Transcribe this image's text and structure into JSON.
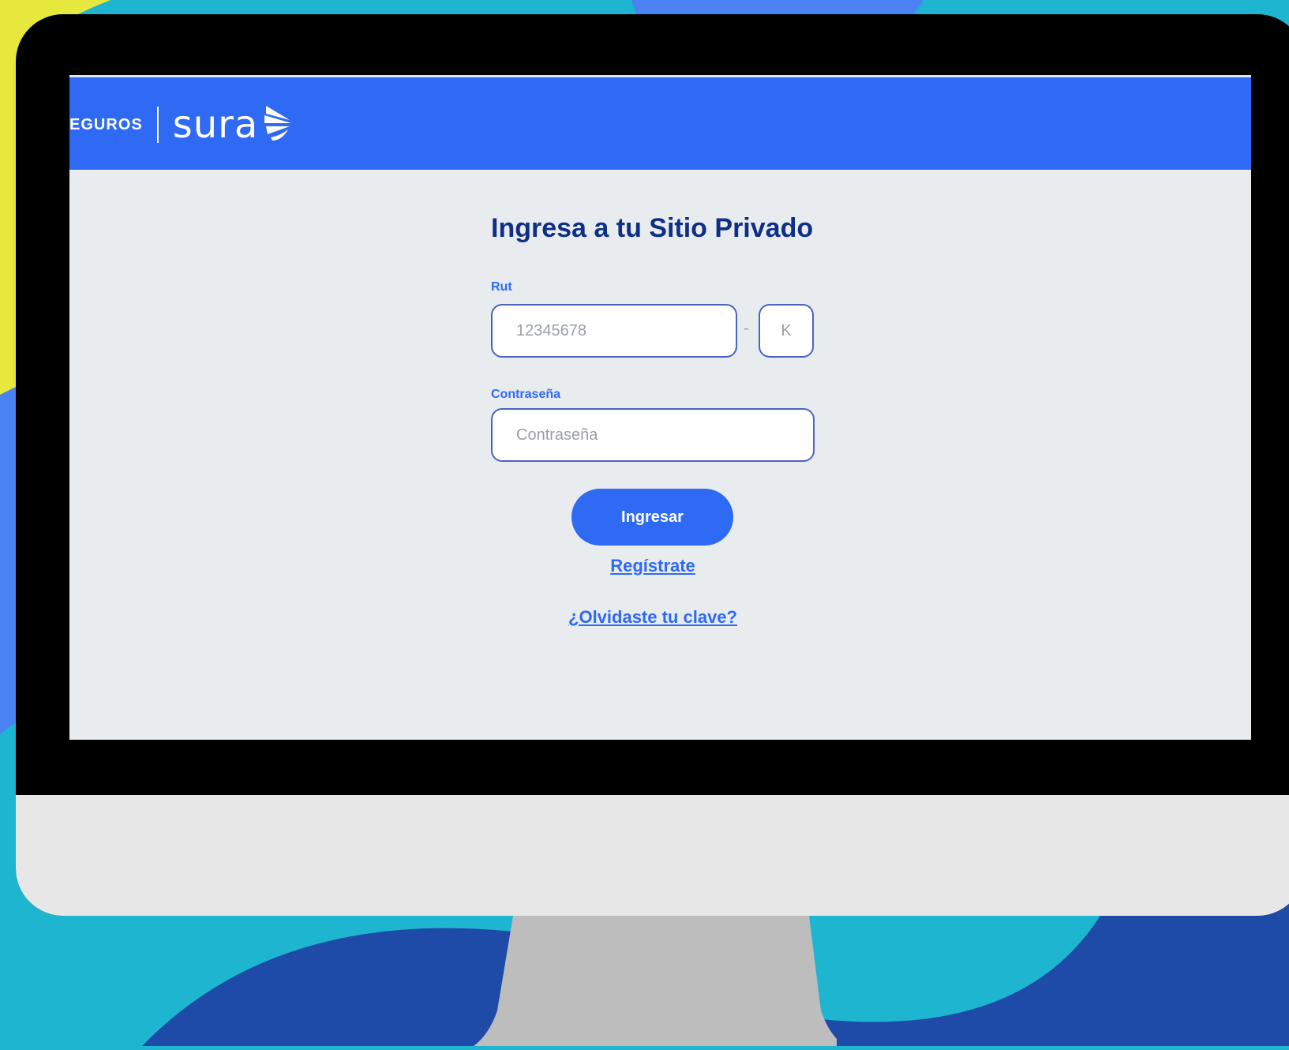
{
  "brand": {
    "seguros": "EGUROS",
    "name": "sura"
  },
  "login": {
    "title": "Ingresa a tu Sitio Privado",
    "rut_label": "Rut",
    "rut_placeholder": "12345678",
    "rut_separator": "-",
    "dv_placeholder": "K",
    "password_label": "Contraseña",
    "password_placeholder": "Contraseña",
    "submit_label": "Ingresar",
    "register_link": "Regístrate",
    "forgot_link": "¿Olvidaste tu clave?"
  },
  "colors": {
    "brand_blue": "#2f6af4",
    "title_navy": "#0f2f86",
    "screen_bg": "#e8ecef"
  },
  "icons": [
    "sura-wing-icon"
  ]
}
